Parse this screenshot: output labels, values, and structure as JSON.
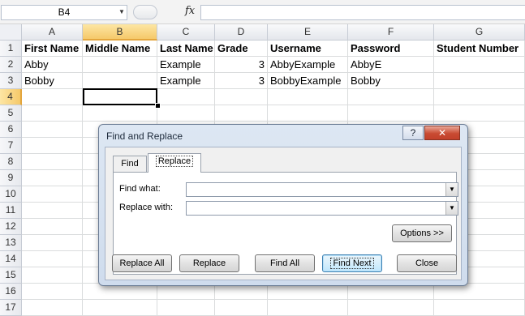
{
  "formula_bar": {
    "name_box": "B4",
    "fx_label": "fx",
    "formula": ""
  },
  "columns": [
    {
      "letter": "A"
    },
    {
      "letter": "B"
    },
    {
      "letter": "C"
    },
    {
      "letter": "D"
    },
    {
      "letter": "E"
    },
    {
      "letter": "F"
    },
    {
      "letter": "G"
    }
  ],
  "rows": [
    "1",
    "2",
    "3",
    "4",
    "5",
    "6",
    "7",
    "8",
    "9",
    "10",
    "11",
    "12",
    "13",
    "14",
    "15",
    "16",
    "17"
  ],
  "cells": {
    "r1": [
      "First Name",
      "Middle Name",
      "Last Name",
      "Grade",
      "Username",
      "Password",
      "Student Number"
    ],
    "r2": [
      "Abby",
      "",
      "Example",
      "3",
      "AbbyExample",
      "AbbyE",
      ""
    ],
    "r3": [
      "Bobby",
      "",
      "Example",
      "3",
      "BobbyExample",
      "Bobby",
      ""
    ]
  },
  "active_cell": "B4",
  "dialog": {
    "title": "Find and Replace",
    "help_label": "?",
    "close_label": "✕",
    "tabs": [
      {
        "label": "Find",
        "active": false
      },
      {
        "label": "Replace",
        "active": true
      }
    ],
    "find_what_label": "Find what:",
    "find_what_value": "",
    "replace_with_label": "Replace with:",
    "replace_with_value": "",
    "buttons": {
      "options": "Options >>",
      "replace_all": "Replace All",
      "replace": "Replace",
      "find_all": "Find All",
      "find_next": "Find Next",
      "close": "Close"
    }
  }
}
